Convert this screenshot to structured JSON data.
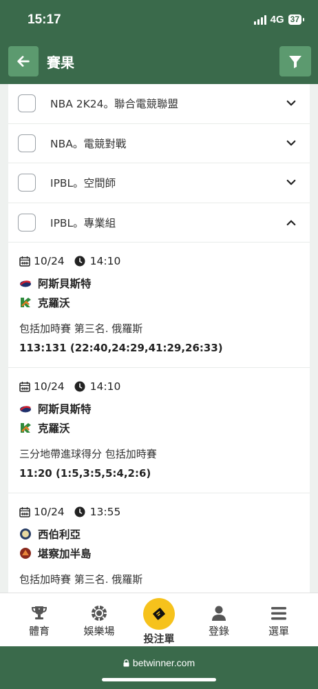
{
  "status_bar": {
    "time": "15:17",
    "network": "4G",
    "battery": "37"
  },
  "header": {
    "title": "賽果",
    "back_icon": "arrow-left-icon",
    "filter_icon": "filter-icon"
  },
  "leagues": [
    {
      "name": "NBA 2K24。聯合電競聯盟",
      "expanded": false
    },
    {
      "name": "NBA。電競對戰",
      "expanded": false
    },
    {
      "name": "IPBL。空間師",
      "expanded": false
    },
    {
      "name": "IPBL。專業組",
      "expanded": true
    }
  ],
  "events": [
    {
      "date": "10/24",
      "time": "14:10",
      "team1": "阿斯貝斯特",
      "team2": "克羅沃",
      "desc": "包括加時賽 第三名. 俄羅斯",
      "score": "113:131 (22:40,24:29,41:29,26:33)"
    },
    {
      "date": "10/24",
      "time": "14:10",
      "team1": "阿斯貝斯特",
      "team2": "克羅沃",
      "desc": "三分地帶進球得分 包括加時賽",
      "score": "11:20 (1:5,3:5,5:4,2:6)"
    },
    {
      "date": "10/24",
      "time": "13:55",
      "team1": "西伯利亞",
      "team2": "堪察加半島",
      "desc": "包括加時賽 第三名. 俄羅斯",
      "score": ""
    }
  ],
  "bottom_nav": [
    {
      "label": "體育",
      "icon": "trophy-icon"
    },
    {
      "label": "娛樂場",
      "icon": "casino-chip-icon"
    },
    {
      "label": "投注單",
      "icon": "bet-slip-icon"
    },
    {
      "label": "登錄",
      "icon": "user-icon"
    },
    {
      "label": "選單",
      "icon": "menu-icon"
    }
  ],
  "browser": {
    "url": "betwinner.com"
  },
  "colors": {
    "primary": "#3a6a4b",
    "button": "#5c9a6f",
    "accent": "#f6c21c"
  }
}
